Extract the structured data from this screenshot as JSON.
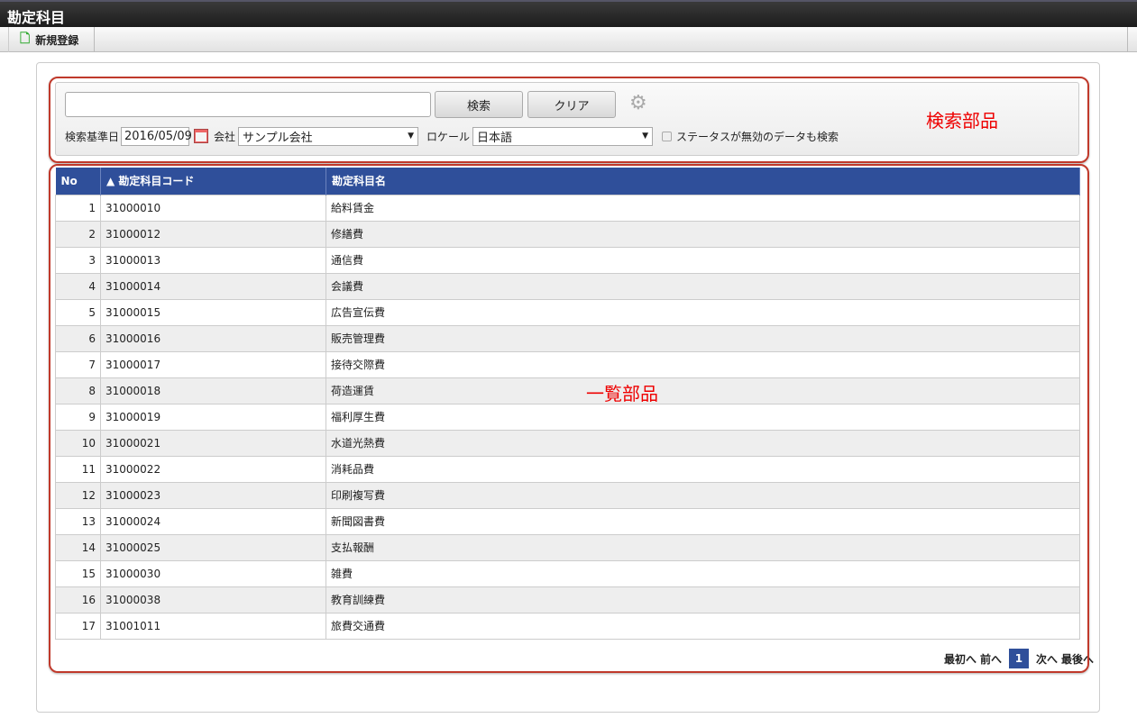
{
  "title": "勘定科目",
  "toolbar": {
    "new_label": "新規登録"
  },
  "search": {
    "keyword": "",
    "search_label": "検索",
    "clear_label": "クリア",
    "date_label": "検索基準日",
    "date_value": "2016/05/09",
    "company_label": "会社",
    "company_value": "サンプル会社",
    "locale_label": "ロケール",
    "locale_value": "日本語",
    "inactive_label": "ステータスが無効のデータも検索"
  },
  "table": {
    "headers": [
      "No",
      "▲ 勘定科目コード",
      "勘定科目名"
    ],
    "rows": [
      [
        "1",
        "31000010",
        "給料賃金"
      ],
      [
        "2",
        "31000012",
        "修繕費"
      ],
      [
        "3",
        "31000013",
        "通信費"
      ],
      [
        "4",
        "31000014",
        "会議費"
      ],
      [
        "5",
        "31000015",
        "広告宣伝費"
      ],
      [
        "6",
        "31000016",
        "販売管理費"
      ],
      [
        "7",
        "31000017",
        "接待交際費"
      ],
      [
        "8",
        "31000018",
        "荷造運賃"
      ],
      [
        "9",
        "31000019",
        "福利厚生費"
      ],
      [
        "10",
        "31000021",
        "水道光熱費"
      ],
      [
        "11",
        "31000022",
        "消耗品費"
      ],
      [
        "12",
        "31000023",
        "印刷複写費"
      ],
      [
        "13",
        "31000024",
        "新聞図書費"
      ],
      [
        "14",
        "31000025",
        "支払報酬"
      ],
      [
        "15",
        "31000030",
        "雑費"
      ],
      [
        "16",
        "31000038",
        "教育訓練費"
      ],
      [
        "17",
        "31001011",
        "旅費交通費"
      ]
    ]
  },
  "pager": {
    "first": "最初へ",
    "prev": "前へ",
    "current": "1",
    "next": "次へ",
    "last": "最後へ"
  },
  "annotations": {
    "search_part": "検索部品",
    "list_part": "一覧部品"
  }
}
